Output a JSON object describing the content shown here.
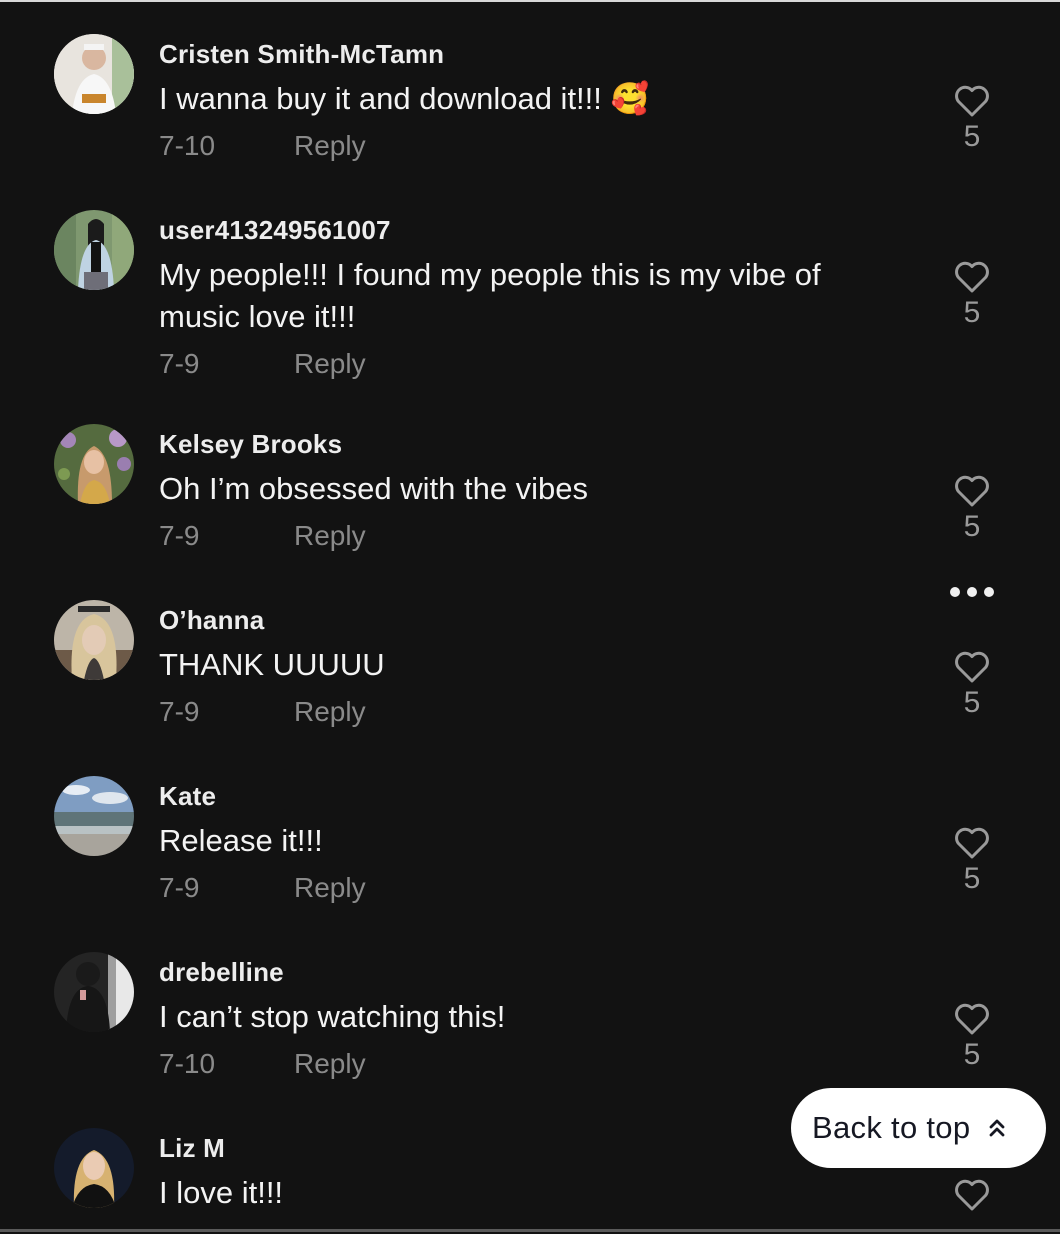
{
  "colors": {
    "background": "#121212",
    "username": "#ededed",
    "comment_text": "#f3f3f3",
    "meta_text": "#8a8a8a",
    "like_icon": "#9a9a9a",
    "back_to_top_bg": "#ffffff",
    "back_to_top_text": "#161823"
  },
  "comments": [
    {
      "username": "Cristen Smith-McTamn",
      "text": "I wanna buy it and download it!!! 🥰",
      "date": "7-10",
      "reply_label": "Reply",
      "likes": "5",
      "avatar": "avatar-photo"
    },
    {
      "username": "user413249561007",
      "text": "My people!!! I found my people this is my vibe of music love it!!!",
      "date": "7-9",
      "reply_label": "Reply",
      "likes": "5",
      "avatar": "avatar-photo"
    },
    {
      "username": "Kelsey Brooks",
      "text": "Oh I’m obsessed with the vibes",
      "date": "7-9",
      "reply_label": "Reply",
      "likes": "5",
      "avatar": "avatar-photo"
    },
    {
      "username": "O’hanna",
      "text": "THANK UUUUU",
      "date": "7-9",
      "reply_label": "Reply",
      "likes": "5",
      "avatar": "avatar-photo",
      "has_more_menu": true
    },
    {
      "username": "Kate",
      "text": "Release it!!!",
      "date": "7-9",
      "reply_label": "Reply",
      "likes": "5",
      "avatar": "avatar-photo"
    },
    {
      "username": "drebelline",
      "text": "I can’t stop watching this!",
      "date": "7-10",
      "reply_label": "Reply",
      "likes": "5",
      "avatar": "avatar-photo"
    },
    {
      "username": "Liz M",
      "text": "I love it!!!",
      "date": "",
      "reply_label": "",
      "likes": "",
      "avatar": "avatar-photo"
    }
  ],
  "back_to_top": {
    "label": "Back to top",
    "icon": "double-chevron-up-icon"
  },
  "icons": {
    "like": "heart-outline-icon",
    "more": "more-horizontal-icon"
  }
}
